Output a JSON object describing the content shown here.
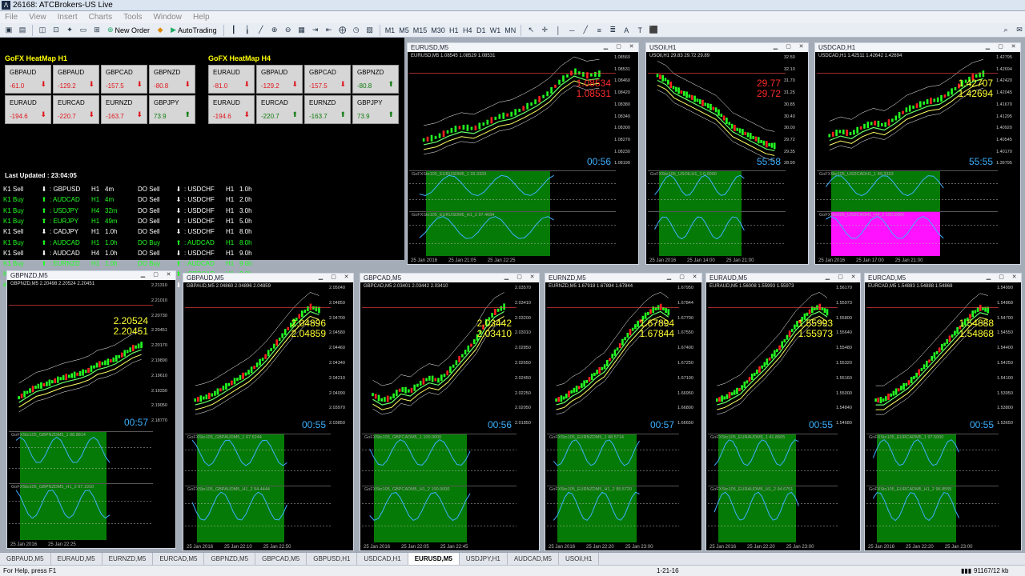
{
  "app": {
    "title": "26168: ATCBrokers-US Live"
  },
  "menu": [
    "File",
    "View",
    "Insert",
    "Charts",
    "Tools",
    "Window",
    "Help"
  ],
  "toolbar": {
    "new_order": "New Order",
    "autotrading": "AutoTrading",
    "timeframes": [
      "M1",
      "M5",
      "M15",
      "M30",
      "H1",
      "H4",
      "D1",
      "W1",
      "MN"
    ]
  },
  "heatmap": {
    "title_h1": "GoFX HeatMap H1",
    "title_h4": "GoFX HeatMap H4",
    "h1": [
      {
        "pair": "GBPAUD",
        "value": "-61.0",
        "dir": "down"
      },
      {
        "pair": "GBPAUD",
        "value": "-129.2",
        "dir": "down"
      },
      {
        "pair": "GBPCAD",
        "value": "-157.5",
        "dir": "down"
      },
      {
        "pair": "GBPNZD",
        "value": "-80.8",
        "dir": "down"
      },
      {
        "pair": "EURAUD",
        "value": "-194.6",
        "dir": "down"
      },
      {
        "pair": "EURCAD",
        "value": "-220.7",
        "dir": "down"
      },
      {
        "pair": "EURNZD",
        "value": "-163.7",
        "dir": "down"
      },
      {
        "pair": "GBPJPY",
        "value": "73.9",
        "dir": "up"
      }
    ],
    "h4": [
      {
        "pair": "EURAUD",
        "value": "-81.0",
        "dir": "down"
      },
      {
        "pair": "GBPAUD",
        "value": "-129.2",
        "dir": "down"
      },
      {
        "pair": "GBPCAD",
        "value": "-157.5",
        "dir": "down"
      },
      {
        "pair": "GBPNZD",
        "value": "-80.8",
        "dir": "up"
      },
      {
        "pair": "EURAUD",
        "value": "-194.6",
        "dir": "down"
      },
      {
        "pair": "EURCAD",
        "value": "-220.7",
        "dir": "up"
      },
      {
        "pair": "EURNZD",
        "value": "-163.7",
        "dir": "up"
      },
      {
        "pair": "GBPJPY",
        "value": "73.9",
        "dir": "up"
      }
    ],
    "last_updated": "Last Updated : 23:04:05",
    "signals_left": [
      {
        "txt": "K1 Sell",
        "dir": "down",
        "pair": ": GBPUSD",
        "tf": "H1",
        "age": "4m",
        "color": "#ffffff"
      },
      {
        "txt": "K1 Buy",
        "dir": "up",
        "pair": ": AUDCAD",
        "tf": "H1",
        "age": "4m",
        "color": "#22ff22"
      },
      {
        "txt": "K1 Buy",
        "dir": "up",
        "pair": ": USDJPY",
        "tf": "H4",
        "age": "32m",
        "color": "#22ff22"
      },
      {
        "txt": "K1 Buy",
        "dir": "up",
        "pair": ": EURJPY",
        "tf": "H1",
        "age": "49m",
        "color": "#22ff22"
      },
      {
        "txt": "K1 Sell",
        "dir": "down",
        "pair": ": CADJPY",
        "tf": "H1",
        "age": "1.0h",
        "color": "#ffffff"
      },
      {
        "txt": "K1 Buy",
        "dir": "up",
        "pair": ": AUDCAD",
        "tf": "H1",
        "age": "1.0h",
        "color": "#22ff22"
      },
      {
        "txt": "K1 Sell",
        "dir": "down",
        "pair": ": AUDCAD",
        "tf": "H4",
        "age": "1.0h",
        "color": "#ffffff"
      },
      {
        "txt": "K1 Buy",
        "dir": "up",
        "pair": ": EURNZD",
        "tf": "H1",
        "age": "1.0h",
        "color": "#22ff22"
      },
      {
        "txt": "K1 Buy",
        "dir": "up",
        "pair": ": GBPAUD",
        "tf": "H1",
        "age": "1.0h",
        "color": "#22ff22"
      },
      {
        "txt": "K1 Buy",
        "dir": "up",
        "pair": ": GBPCAD",
        "tf": "H1",
        "age": "2.0h",
        "color": "#22ff22"
      }
    ],
    "signals_right": [
      {
        "txt": "DO Sell",
        "dir": "down",
        "pair": ": USDCHF",
        "tf": "H1",
        "age": "1.0h",
        "color": "#ffffff"
      },
      {
        "txt": "DO Sell",
        "dir": "down",
        "pair": ": USDCHF",
        "tf": "H1",
        "age": "2.0h",
        "color": "#ffffff"
      },
      {
        "txt": "DO Sell",
        "dir": "down",
        "pair": ": USDCHF",
        "tf": "H1",
        "age": "3.0h",
        "color": "#ffffff"
      },
      {
        "txt": "DO Sell",
        "dir": "down",
        "pair": ": USDCHF",
        "tf": "H1",
        "age": "5.0h",
        "color": "#ffffff"
      },
      {
        "txt": "DO Sell",
        "dir": "down",
        "pair": ": USDCHF",
        "tf": "H1",
        "age": "8.0h",
        "color": "#ffffff"
      },
      {
        "txt": "DO Buy",
        "dir": "up",
        "pair": ": AUDCAD",
        "tf": "H1",
        "age": "8.0h",
        "color": "#22ff22"
      },
      {
        "txt": "DO Sell",
        "dir": "down",
        "pair": ": USDCHF",
        "tf": "H1",
        "age": "9.0h",
        "color": "#ffffff"
      },
      {
        "txt": "DO Buy",
        "dir": "up",
        "pair": ": AUDCAD",
        "tf": "H1",
        "age": "9.0h",
        "color": "#22ff22"
      },
      {
        "txt": "DO Buy",
        "dir": "up",
        "pair": ": GBPCAD",
        "tf": "H1",
        "age": "9.0h",
        "color": "#22ff22"
      },
      {
        "txt": "DO Sell",
        "dir": "down",
        "pair": ": USDCHF",
        "tf": "H1",
        "age": "10.0h",
        "color": "#ffffff"
      }
    ]
  },
  "charts": [
    {
      "title": "EURUSD,M5",
      "ohlc": "EURUSD,M5  1.08545 1.08529 1.08531",
      "bid": "1.08534",
      "ask": "1.08531",
      "price_color": "red",
      "timer": "00:56",
      "axis": [
        "1.08560",
        "1.08531",
        "1.08460",
        "1.08420",
        "1.08380",
        "1.08340",
        "1.08300",
        "1.08270",
        "1.08230",
        "1.08190"
      ],
      "times": [
        "25 Jan 2016",
        "25 Jan 21:05",
        "25 Jan 22:25"
      ],
      "ind1": "GoFXSto105_EURUSDM5_1 33.3333",
      "ind2": "GoFXSto105_EURUSDM5_H1_2 97.4684",
      "trend": [
        0.15,
        0.18,
        0.25,
        0.3,
        0.28,
        0.35,
        0.42,
        0.45,
        0.52,
        0.6,
        0.7,
        0.85,
        0.95,
        0.9,
        0.92
      ]
    },
    {
      "title": "USOil,H1",
      "ohlc": "USOil,H1  29.83 29.72 29.89",
      "bid": "29.77",
      "ask": "29.72",
      "price_color": "red",
      "timer": "55:58",
      "axis": [
        "32.50",
        "32.10",
        "31.70",
        "31.25",
        "30.85",
        "30.40",
        "30.00",
        "29.72",
        "29.35",
        "28.90"
      ],
      "times": [
        "25 Jan 2016",
        "25 Jan 14:00",
        "25 Jan 21:00"
      ],
      "ind1": "GoFXSto105_USOILH1_1 0.0000",
      "ind2": "",
      "trend": [
        0.9,
        0.85,
        0.75,
        0.7,
        0.65,
        0.6,
        0.55,
        0.5,
        0.4,
        0.3,
        0.25,
        0.2,
        0.15,
        0.1,
        0.08
      ]
    },
    {
      "title": "USDCAD,H1",
      "ohlc": "USDCAD,H1  1.42511 1.42642 1.42694",
      "bid": "1.42707",
      "ask": "1.42694",
      "price_color": "yellow",
      "timer": "55:55",
      "axis": [
        "1.42795",
        "1.42694",
        "1.42420",
        "1.42045",
        "1.41670",
        "1.41295",
        "1.40920",
        "1.40545",
        "1.40170",
        "1.39795"
      ],
      "times": [
        "25 Jan 2016",
        "25 Jan 17:00",
        "25 Jan 21:00"
      ],
      "ind1": "GoFXSto105_USDCADH1_1 89.3333",
      "ind2": "GoFXSto105_USDCADH1_H4_2 100.0000",
      "trend": [
        0.2,
        0.25,
        0.22,
        0.3,
        0.35,
        0.32,
        0.4,
        0.5,
        0.55,
        0.6,
        0.62,
        0.7,
        0.8,
        0.88,
        0.92
      ]
    },
    {
      "title": "GBPNZD,M5",
      "ohlc": "GBPNZD,M5  2.20498 2.20524 2.20451",
      "bid": "2.20524",
      "ask": "2.20451",
      "price_color": "yellow",
      "timer": "00:57",
      "axis": [
        "2.21310",
        "2.21010",
        "2.20730",
        "2.20451",
        "2.20170",
        "2.19890",
        "2.19610",
        "2.19330",
        "2.19050",
        "2.18770"
      ],
      "times": [
        "25 Jan 2016",
        "25 Jan 22:25"
      ],
      "ind1": "GoFXSto105_GBPNZDM5_1 88.8814",
      "ind2": "GoFXSto105_GBPNZDM5_H1_2 97.1910",
      "trend": [
        0.1,
        0.15,
        0.2,
        0.22,
        0.25,
        0.28,
        0.3,
        0.32,
        0.35,
        0.4,
        0.42,
        0.45,
        0.5,
        0.55,
        0.58
      ]
    },
    {
      "title": "GBPAUD,M5",
      "ohlc": "GBPAUD,M5  2.04860 2.04896 2.04859",
      "bid": "2.04896",
      "ask": "2.04859",
      "price_color": "yellow",
      "timer": "00:55",
      "axis": [
        "2.05040",
        "2.04859",
        "2.04700",
        "2.04580",
        "2.04460",
        "2.04340",
        "2.04210",
        "2.04090",
        "2.03970",
        "2.03850"
      ],
      "times": [
        "25 Jan 2016",
        "25 Jan 22:10",
        "25 Jan 22:50"
      ],
      "ind1": "GoFXSto105_GBPAUDM5_1 67.5244",
      "ind2": "GoFXSto105_GBPAUDM5_H1_2 94.4444",
      "trend": [
        0.1,
        0.12,
        0.15,
        0.2,
        0.25,
        0.3,
        0.35,
        0.42,
        0.5,
        0.6,
        0.7,
        0.8,
        0.88,
        0.95,
        0.92
      ]
    },
    {
      "title": "GBPCAD,M5",
      "ohlc": "GBPCAD,M5  2.03401 2.03442 2.03410",
      "bid": "2.03442",
      "ask": "2.03410",
      "price_color": "yellow",
      "timer": "00:56",
      "axis": [
        "2.03570",
        "2.03410",
        "2.03200",
        "2.03010",
        "2.02850",
        "2.02650",
        "2.02450",
        "2.02250",
        "2.02050",
        "2.01850"
      ],
      "times": [
        "25 Jan 2016",
        "25 Jan 22:05",
        "25 Jan 22:45"
      ],
      "ind1": "GoFXSto105_GBPCADM5_1 100.0000",
      "ind2": "GoFXSto105_GBPCADM5_H1_2 100.0000",
      "trend": [
        0.15,
        0.1,
        0.12,
        0.2,
        0.18,
        0.25,
        0.3,
        0.28,
        0.35,
        0.45,
        0.55,
        0.65,
        0.8,
        0.9,
        0.95
      ]
    },
    {
      "title": "EURNZD,M5",
      "ohlc": "EURNZD,M5  1.67918 1.67894 1.67844",
      "bid": "1.67894",
      "ask": "1.67844",
      "price_color": "yellow",
      "timer": "00:57",
      "axis": [
        "1.67950",
        "1.67844",
        "1.67700",
        "1.67550",
        "1.67400",
        "1.67250",
        "1.67100",
        "1.66950",
        "1.66800",
        "1.66650"
      ],
      "times": [
        "25 Jan 2016",
        "25 Jan 22:20",
        "25 Jan 23:00"
      ],
      "ind1": "GoFXSto105_EURNZDM5_1 48.5714",
      "ind2": "GoFXSto105_EURNZDM5_H1_2 95.5720",
      "trend": [
        0.1,
        0.12,
        0.18,
        0.22,
        0.28,
        0.35,
        0.4,
        0.5,
        0.6,
        0.7,
        0.78,
        0.86,
        0.92,
        0.95,
        0.9
      ]
    },
    {
      "title": "EURAUD,M5",
      "ohlc": "EURAUD,M5  1.56008 1.55993 1.55973",
      "bid": "1.55993",
      "ask": "1.55973",
      "price_color": "yellow",
      "timer": "00:55",
      "axis": [
        "1.56170",
        "1.55973",
        "1.55800",
        "1.55640",
        "1.55480",
        "1.55320",
        "1.55160",
        "1.55000",
        "1.54840",
        "1.54680"
      ],
      "times": [
        "25 Jan 2016",
        "25 Jan 22:20",
        "25 Jan 23:00"
      ],
      "ind1": "GoFXSto105_EURAUDM5_1 41.8605",
      "ind2": "GoFXSto105_EURAUDM5_H1_2 94.6751",
      "trend": [
        0.1,
        0.12,
        0.16,
        0.2,
        0.28,
        0.35,
        0.42,
        0.5,
        0.58,
        0.68,
        0.78,
        0.85,
        0.92,
        0.95,
        0.9
      ]
    },
    {
      "title": "EURCAD,M5",
      "ohlc": "EURCAD,M5  1.54883 1.54888 1.54868",
      "bid": "1.54888",
      "ask": "1.54868",
      "price_color": "yellow",
      "timer": "00:55",
      "axis": [
        "1.54990",
        "1.54868",
        "1.54700",
        "1.54550",
        "1.54400",
        "1.54250",
        "1.54100",
        "1.53950",
        "1.53800",
        "1.53650"
      ],
      "times": [
        "25 Jan 2016",
        "25 Jan 22:20",
        "25 Jan 23:00"
      ],
      "ind1": "GoFXSto105_EURCADM5_1 97.5000",
      "ind2": "GoFXSto105_EURCADM5_H1_2 96.8555",
      "trend": [
        0.1,
        0.1,
        0.15,
        0.2,
        0.25,
        0.32,
        0.4,
        0.48,
        0.56,
        0.64,
        0.72,
        0.8,
        0.88,
        0.94,
        0.92
      ]
    }
  ],
  "tabs": [
    "GBPAUD,M5",
    "EURAUD,M5",
    "EURNZD,M5",
    "EURCAD,M5",
    "GBPNZD,M5",
    "GBPCAD,M5",
    "GBPUSD,H1",
    "USDCAD,H1",
    "EURUSD,M5",
    "USDJPY,H1",
    "AUDCAD,M5",
    "USOil,H1"
  ],
  "active_tab": "EURUSD,M5",
  "status": {
    "help": "For Help, press F1",
    "date": "1-21-16",
    "traffic": "91167/12 kb"
  },
  "colors": {
    "plot_bg": "#0f1fd6",
    "ind_fill": "#067a06",
    "price": "#ffff33",
    "timer": "#3bb0ff"
  }
}
